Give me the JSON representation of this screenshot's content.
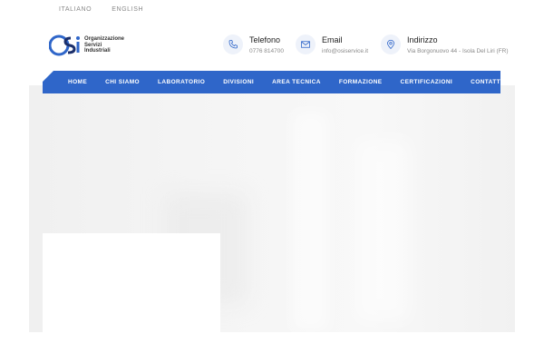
{
  "languages": [
    "ITALIANO",
    "ENGLISH"
  ],
  "logo": {
    "letters": "OSI",
    "lines": [
      "Organizzazione",
      "Servizi",
      "Industriali"
    ]
  },
  "contacts": {
    "phone": {
      "title": "Telefono",
      "value": "0776 814700",
      "icon": "phone-icon"
    },
    "email": {
      "title": "Email",
      "value": "info@osiservice.it",
      "icon": "envelope-icon"
    },
    "address": {
      "title": "Indirizzo",
      "value": "Via Borgonuovo 44 - Isola Del Liri (FR)",
      "icon": "map-pin-icon"
    }
  },
  "nav": [
    "HOME",
    "CHI SIAMO",
    "LABORATORIO",
    "DIVISIONI",
    "AREA TECNICA",
    "FORMAZIONE",
    "CERTIFICAZIONI",
    "CONTATTI"
  ],
  "colors": {
    "accent": "#2f66c9",
    "icon_bg": "#eef2fa",
    "muted": "#8a8a8a"
  }
}
